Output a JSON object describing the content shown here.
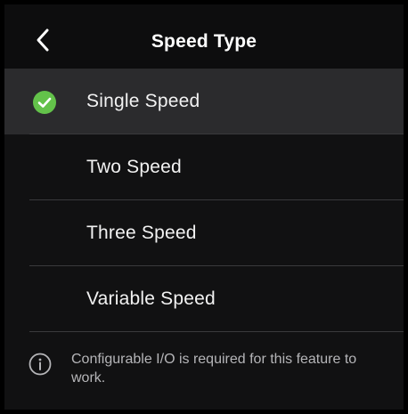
{
  "header": {
    "back_icon": "chevron-left-icon",
    "title": "Speed Type"
  },
  "options": [
    {
      "label": "Single Speed",
      "selected": true
    },
    {
      "label": "Two Speed",
      "selected": false
    },
    {
      "label": "Three Speed",
      "selected": false
    },
    {
      "label": "Variable Speed",
      "selected": false
    }
  ],
  "info": {
    "icon": "info-icon",
    "text": "Configurable I/O is required for this feature to work."
  },
  "colors": {
    "accent_check": "#63c24a",
    "selected_row": "#2b2b2d",
    "background": "#111112"
  }
}
